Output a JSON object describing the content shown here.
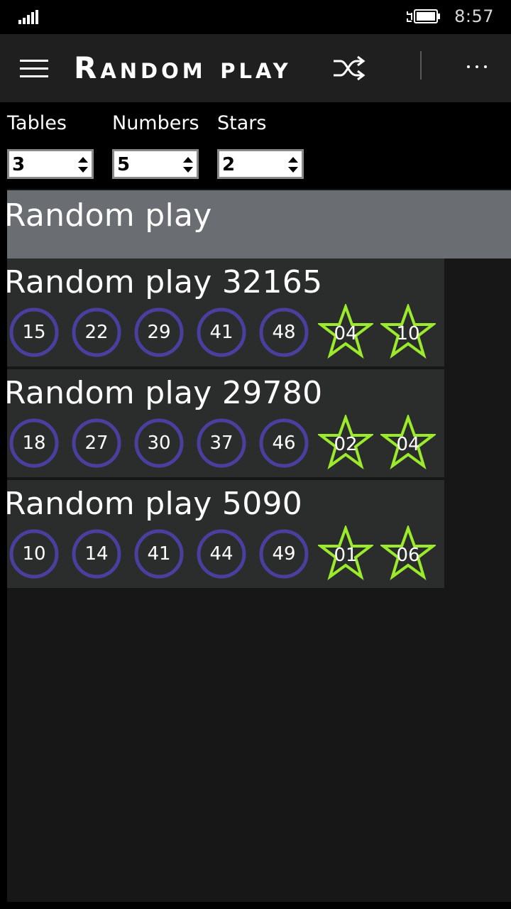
{
  "status_bar": {
    "time": "8:57",
    "icons": [
      "signal-icon",
      "battery-charging-icon"
    ]
  },
  "app_bar": {
    "title": "Random play",
    "actions": [
      "menu-icon",
      "shuffle-icon",
      "more-icon"
    ]
  },
  "controls": {
    "tables": {
      "label": "Tables",
      "value": "3"
    },
    "numbers": {
      "label": "Numbers",
      "value": "5"
    },
    "stars": {
      "label": "Stars",
      "value": "2"
    }
  },
  "list": {
    "header": "Random play",
    "cards": [
      {
        "title": "Random play 32165",
        "numbers": [
          "15",
          "22",
          "29",
          "41",
          "48"
        ],
        "stars": [
          "04",
          "10"
        ]
      },
      {
        "title": "Random play 29780",
        "numbers": [
          "18",
          "27",
          "30",
          "37",
          "46"
        ],
        "stars": [
          "02",
          "04"
        ]
      },
      {
        "title": "Random play 5090",
        "numbers": [
          "10",
          "14",
          "41",
          "44",
          "49"
        ],
        "stars": [
          "01",
          "06"
        ]
      }
    ]
  },
  "colors": {
    "ball_ring": "#4a3f9e",
    "star_outline": "#9bea2c",
    "card_bg": "#2b2d2d",
    "header_band": "#6a6d71"
  }
}
